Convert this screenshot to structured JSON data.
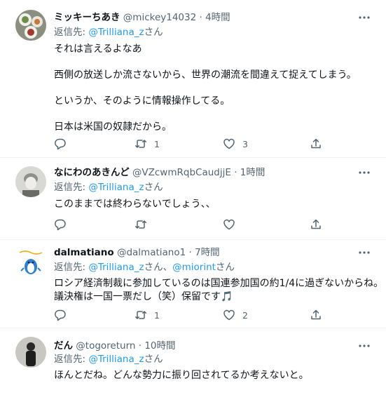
{
  "tweets": [
    {
      "name": "ミッキーちあき",
      "handle": "@mickey14032",
      "time": "· 4時間",
      "reply_prefix": "返信先: ",
      "reply_to": "@Trilliana_z",
      "reply_suffix": "さん",
      "lines": [
        "それは言えるよなあ",
        "西側の放送しか流さないから、世界の潮流を間違えて捉えてしまう。",
        "というか、そのように情報操作してる。",
        "日本は米国の奴隷だから。"
      ],
      "replies": "",
      "retweets": "1",
      "likes": "3"
    },
    {
      "name": "なにわのあきんど",
      "handle": "@VZcwmRqbCaudjjE",
      "time": "· 1時間",
      "reply_prefix": "返信先: ",
      "reply_to": "@Trilliana_z",
      "reply_suffix": "さん",
      "lines": [
        "このままでは終わらないでしょう、、"
      ],
      "replies": "",
      "retweets": "",
      "likes": ""
    },
    {
      "name": "dalmatiano",
      "handle": "@dalmatiano1",
      "time": "· 7時間",
      "reply_prefix": "返信先: ",
      "reply_to": "@Trilliana_z",
      "reply_mid": "さん、",
      "reply_to2": "@miorint",
      "reply_suffix": "さん",
      "line1": "ロシア経済制裁に参加しているのは国連参加国の約1/4に過ぎないからね。",
      "line2": "議決権は一国一票だし（笑）保留です",
      "emoji": "🎵",
      "replies": "",
      "retweets": "1",
      "likes": "2"
    },
    {
      "name": "だん",
      "handle": "@togoreturn",
      "time": "· 10時間",
      "reply_prefix": "返信先: ",
      "reply_to": "@Trilliana_z",
      "reply_suffix": "さん",
      "lines": [
        "ほんとだね。どんな勢力に振り回されてるか考えないと。"
      ]
    }
  ],
  "icons": {
    "more": "more-icon",
    "reply": "reply-icon",
    "retweet": "retweet-icon",
    "like": "like-icon",
    "share": "share-icon"
  },
  "colors": {
    "accent": "#1d9bf0",
    "muted": "#536471",
    "text": "#0f1419"
  }
}
